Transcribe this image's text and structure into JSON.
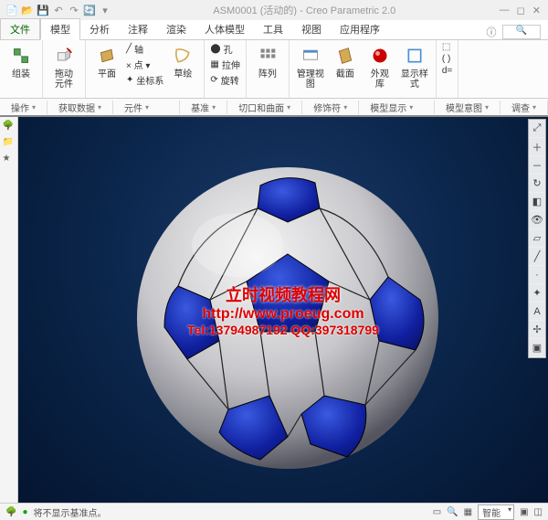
{
  "title": "ASM0001 (活动的) - Creo Parametric 2.0",
  "menu": {
    "file": "文件",
    "tabs": [
      "模型",
      "分析",
      "注释",
      "渲染",
      "人体模型",
      "工具",
      "视图",
      "应用程序"
    ]
  },
  "ribbon": {
    "assemble": "组装",
    "drag": "拖动\n元件",
    "plane": "平面",
    "sketch": "草绘",
    "hole": "孔",
    "extrude": "拉伸",
    "revolve": "旋转",
    "pattern": "阵列",
    "manage_view": "管理视图",
    "section": "截面",
    "appearance": "外观\n库",
    "display_style": "显示样\n式",
    "small_axis": "轴",
    "small_point": "× 点 ▾",
    "small_csys": "坐标系"
  },
  "subbar": {
    "operate": "操作",
    "get_data": "获取数据",
    "component": "元件",
    "datum": "基准",
    "cut_surface": "切口和曲面",
    "modifier": "修饰符",
    "model_display": "模型显示",
    "model_intent": "模型意图",
    "investigate": "调查"
  },
  "watermark": {
    "line1": "立时视频教程网",
    "line2": "http://www.proeug.com",
    "line3": "Tel:13794987192   QQ:397318799"
  },
  "statusbar": {
    "msg": "将不显示基准点。",
    "combo": "智能"
  }
}
